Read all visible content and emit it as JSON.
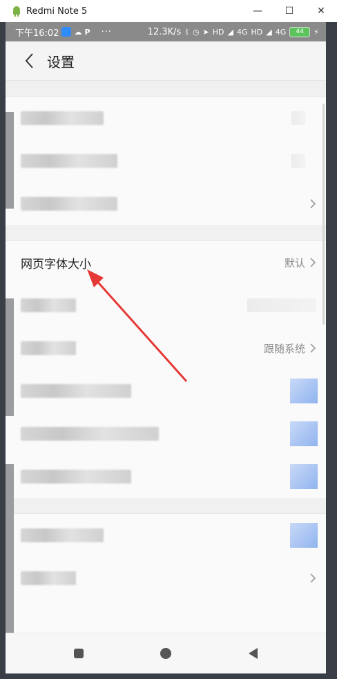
{
  "window": {
    "title": "Redmi Note 5",
    "controls": [
      "—",
      "☐",
      "✕"
    ]
  },
  "statusbar": {
    "time": "下午16:02",
    "dots": "···",
    "speed": "12.3K/s",
    "net1": "4G",
    "net2": "4G",
    "battery": "44"
  },
  "appbar": {
    "title": "设置"
  },
  "settings": {
    "font_size_label": "网页字体大小",
    "font_size_value": "默认",
    "row_system_value": "跟随系统"
  },
  "colors": {
    "arrow": "#e53935",
    "status_bg": "#8a8a8a",
    "battery": "#5cc45c"
  }
}
